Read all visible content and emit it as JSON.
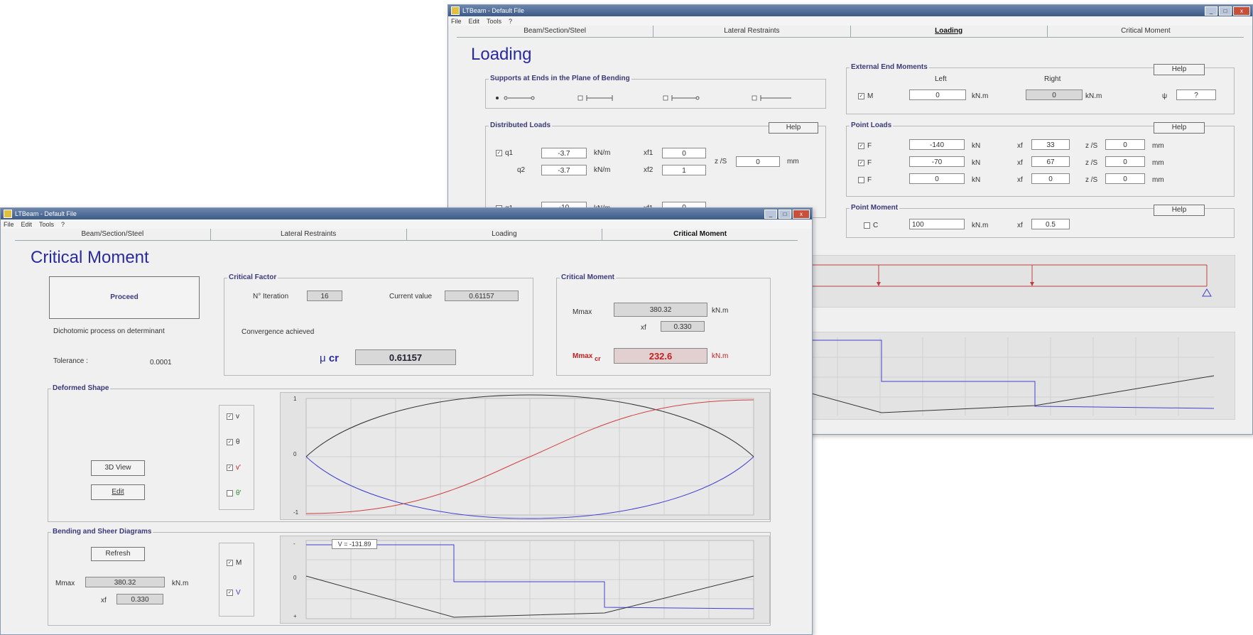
{
  "back": {
    "title": "LTBeam - Default File",
    "menu": [
      "File",
      "Edit",
      "Tools",
      "?"
    ],
    "tabs": [
      "Beam/Section/Steel",
      "Lateral Restraints",
      "Loading",
      "Critical Moment"
    ],
    "heading": "Loading",
    "supports": {
      "title": "Supports at Ends in the Plane of Bending"
    },
    "distributed": {
      "title": "Distributed Loads",
      "help": "Help",
      "rows": [
        {
          "check": "q1",
          "q": "-3.7",
          "unit": "kN/m",
          "xlabel": "xf1",
          "x": "0"
        },
        {
          "check": "q2",
          "q": "-3.7",
          "unit": "kN/m",
          "xlabel": "xf2",
          "x": "1"
        },
        {
          "check": "q1",
          "q": "-10",
          "unit": "kN/m",
          "xlabel": "xf1",
          "x": "0"
        }
      ],
      "z_label": "z /S",
      "z": "0",
      "z_unit": "mm"
    },
    "external": {
      "title": "External End Moments",
      "help": "Help",
      "left": "Left",
      "right": "Right",
      "check": "M",
      "left_val": "0",
      "unit": "kN.m",
      "right_val": "0",
      "psi_label": "ψ",
      "psi_val": "?"
    },
    "point_loads": {
      "title": "Point Loads",
      "help": "Help",
      "rows": [
        {
          "check": "F",
          "f": "-140",
          "unit": "kN",
          "xlabel": "xf",
          "x": "33",
          "zlabel": "z /S",
          "z": "0",
          "zunit": "mm"
        },
        {
          "check": "F",
          "f": "-70",
          "unit": "kN",
          "xlabel": "xf",
          "x": "67",
          "zlabel": "z /S",
          "z": "0",
          "zunit": "mm"
        },
        {
          "check": "F",
          "f": "0",
          "unit": "kN",
          "xlabel": "xf",
          "x": "0",
          "zlabel": "z /S",
          "z": "0",
          "zunit": "mm"
        }
      ]
    },
    "point_moment": {
      "title": "Point Moment",
      "help": "Help",
      "check": "C",
      "value": "100",
      "unit": "kN.m",
      "xlabel": "xf",
      "x": "0.5"
    }
  },
  "front": {
    "title": "LTBeam - Default File",
    "menu": [
      "File",
      "Edit",
      "Tools",
      "?"
    ],
    "tabs": [
      "Beam/Section/Steel",
      "Lateral Restraints",
      "Loading",
      "Critical Moment"
    ],
    "heading": "Critical Moment",
    "proceed": "Proceed",
    "process_text": "Dichotomic process on determinant",
    "tolerance_label": "Tolerance :",
    "tolerance": "0.0001",
    "critical_factor": {
      "title": "Critical Factor",
      "iter_label": "N° Iteration",
      "iter": "16",
      "current_label": "Current value",
      "current": "0.61157",
      "convergence": "Convergence achieved",
      "mu_symbol": "μ",
      "mu_sub": "cr",
      "mu": "0.61157"
    },
    "critical_moment": {
      "title": "Critical Moment",
      "mmax_label": "Mmax",
      "mmax": "380.32",
      "unit": "kN.m",
      "xf_label": "xf",
      "xf": "0.330",
      "mcr_label": "Mmax",
      "mcr_sub": "cr",
      "mcr": "232.6",
      "mcr_unit": "kN.m"
    },
    "deformed": {
      "title": "Deformed Shape",
      "view3d": "3D View",
      "edit": "Edit",
      "checks": [
        {
          "label": "v",
          "checked": true
        },
        {
          "label": "θ",
          "checked": true
        },
        {
          "label": "v'",
          "checked": true
        },
        {
          "label": "θ'",
          "checked": false
        }
      ],
      "axis": {
        "top": "1",
        "mid": "0",
        "bot": "-1"
      }
    },
    "bending": {
      "title": "Bending and Sheer Diagrams",
      "refresh": "Refresh",
      "mmax_label": "Mmax",
      "mmax": "380.32",
      "unit": "kN.m",
      "xf_label": "xf",
      "xf": "0.330",
      "checks": [
        {
          "label": "M",
          "checked": true
        },
        {
          "label": "V",
          "checked": true
        }
      ],
      "tooltip": "V = -131.89",
      "axis": {
        "top": "-",
        "mid": "0",
        "bot": "+"
      }
    }
  }
}
